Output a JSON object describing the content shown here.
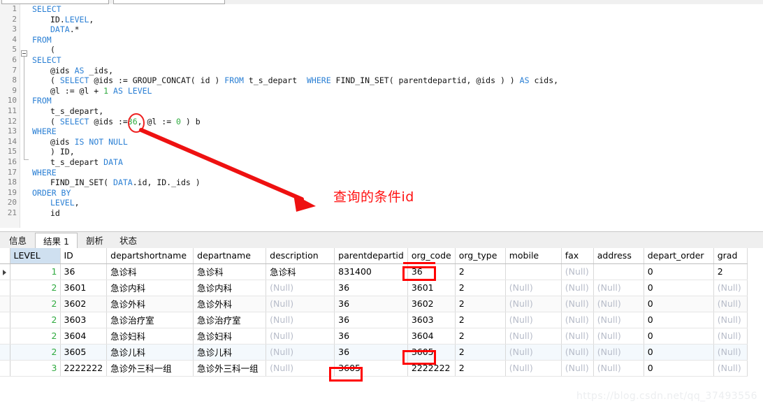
{
  "toolbar": {
    "box1_label": "",
    "box2_label": ""
  },
  "editor": {
    "lines": [
      {
        "n": "1",
        "tokens": [
          {
            "t": "SELECT",
            "c": "kw"
          }
        ],
        "indent": 0
      },
      {
        "n": "2",
        "tokens": [
          {
            "t": "ID.",
            "c": "plain"
          },
          {
            "t": "LEVEL",
            "c": "kw"
          },
          {
            "t": ",",
            "c": "plain"
          }
        ],
        "indent": 1
      },
      {
        "n": "3",
        "tokens": [
          {
            "t": "DATA",
            "c": "kw"
          },
          {
            "t": ".*",
            "c": "plain"
          }
        ],
        "indent": 1
      },
      {
        "n": "4",
        "tokens": [
          {
            "t": "FROM",
            "c": "kw"
          }
        ],
        "indent": 0
      },
      {
        "n": "5",
        "tokens": [
          {
            "t": "(",
            "c": "plain"
          }
        ],
        "indent": 1
      },
      {
        "n": "6",
        "tokens": [
          {
            "t": "SELECT",
            "c": "kw"
          }
        ],
        "indent": 0
      },
      {
        "n": "7",
        "tokens": [
          {
            "t": "@ids ",
            "c": "plain"
          },
          {
            "t": "AS",
            "c": "kw"
          },
          {
            "t": " _ids,",
            "c": "plain"
          }
        ],
        "indent": 1
      },
      {
        "n": "8",
        "tokens": [
          {
            "t": "( ",
            "c": "plain"
          },
          {
            "t": "SELECT",
            "c": "kw"
          },
          {
            "t": " @ids := GROUP_CONCAT( id ) ",
            "c": "plain"
          },
          {
            "t": "FROM",
            "c": "kw"
          },
          {
            "t": " t_s_depart  ",
            "c": "plain"
          },
          {
            "t": "WHERE",
            "c": "kw"
          },
          {
            "t": " FIND_IN_SET( parentdepartid, @ids ) ) ",
            "c": "plain"
          },
          {
            "t": "AS",
            "c": "kw"
          },
          {
            "t": " cids,",
            "c": "plain"
          }
        ],
        "indent": 1
      },
      {
        "n": "9",
        "tokens": [
          {
            "t": "@l := @l + ",
            "c": "plain"
          },
          {
            "t": "1",
            "c": "num"
          },
          {
            "t": " ",
            "c": "plain"
          },
          {
            "t": "AS",
            "c": "kw"
          },
          {
            "t": " ",
            "c": "plain"
          },
          {
            "t": "LEVEL",
            "c": "kw"
          }
        ],
        "indent": 1
      },
      {
        "n": "10",
        "tokens": [
          {
            "t": "FROM",
            "c": "kw"
          }
        ],
        "indent": 0
      },
      {
        "n": "11",
        "tokens": [
          {
            "t": "t_s_depart,",
            "c": "plain"
          }
        ],
        "indent": 1
      },
      {
        "n": "12",
        "tokens": [
          {
            "t": "( ",
            "c": "plain"
          },
          {
            "t": "SELECT",
            "c": "kw"
          },
          {
            "t": " @ids :=",
            "c": "plain"
          },
          {
            "t": "36",
            "c": "num"
          },
          {
            "t": ", @l := ",
            "c": "plain"
          },
          {
            "t": "0",
            "c": "num"
          },
          {
            "t": " ) b",
            "c": "plain"
          }
        ],
        "indent": 1
      },
      {
        "n": "13",
        "tokens": [
          {
            "t": "WHERE",
            "c": "kw"
          }
        ],
        "indent": 0
      },
      {
        "n": "14",
        "tokens": [
          {
            "t": "@ids ",
            "c": "plain"
          },
          {
            "t": "IS NOT NULL",
            "c": "kw"
          }
        ],
        "indent": 1
      },
      {
        "n": "15",
        "tokens": [
          {
            "t": ") ID,",
            "c": "plain"
          }
        ],
        "indent": 1
      },
      {
        "n": "16",
        "tokens": [
          {
            "t": "t_s_depart ",
            "c": "plain"
          },
          {
            "t": "DATA",
            "c": "kw"
          }
        ],
        "indent": 1
      },
      {
        "n": "17",
        "tokens": [
          {
            "t": "WHERE",
            "c": "kw"
          }
        ],
        "indent": 0
      },
      {
        "n": "18",
        "tokens": [
          {
            "t": "FIND_IN_SET( ",
            "c": "plain"
          },
          {
            "t": "DATA",
            "c": "kw"
          },
          {
            "t": ".id, ID._ids )",
            "c": "plain"
          }
        ],
        "indent": 1
      },
      {
        "n": "19",
        "tokens": [
          {
            "t": "ORDER BY",
            "c": "kw"
          }
        ],
        "indent": 0
      },
      {
        "n": "20",
        "tokens": [
          {
            "t": "LEVEL",
            "c": "kw"
          },
          {
            "t": ",",
            "c": "plain"
          }
        ],
        "indent": 1
      },
      {
        "n": "21",
        "tokens": [
          {
            "t": "id",
            "c": "plain"
          }
        ],
        "indent": 1
      }
    ]
  },
  "annotation": {
    "text": "查询的条件id",
    "color": "#ff1111",
    "circled_value": "36"
  },
  "result_tabs": [
    {
      "label": "信息",
      "active": false
    },
    {
      "label": "结果 1",
      "active": true
    },
    {
      "label": "剖析",
      "active": false
    },
    {
      "label": "状态",
      "active": false
    }
  ],
  "grid": {
    "columns": [
      "LEVEL",
      "ID",
      "departshortname",
      "departname",
      "description",
      "parentdepartid",
      "org_code",
      "org_type",
      "mobile",
      "fax",
      "address",
      "depart_order",
      "grad"
    ],
    "selected_column": "LEVEL",
    "null_label": "(Null)",
    "rows": [
      {
        "current": true,
        "cells": [
          "1",
          "36",
          "急诊科",
          "急诊科",
          "急诊科",
          "831400",
          "36",
          "2",
          "",
          "(Null)",
          "",
          "0",
          "2"
        ]
      },
      {
        "current": false,
        "cells": [
          "2",
          "3601",
          "急诊内科",
          "急诊内科",
          "(Null)",
          "36",
          "3601",
          "2",
          "(Null)",
          "(Null)",
          "(Null)",
          "0",
          "(Null)"
        ]
      },
      {
        "current": false,
        "cells": [
          "2",
          "3602",
          "急诊外科",
          "急诊外科",
          "(Null)",
          "36",
          "3602",
          "2",
          "(Null)",
          "(Null)",
          "(Null)",
          "0",
          "(Null)"
        ]
      },
      {
        "current": false,
        "cells": [
          "2",
          "3603",
          "急诊治疗室",
          "急诊治疗室",
          "(Null)",
          "36",
          "3603",
          "2",
          "(Null)",
          "(Null)",
          "(Null)",
          "0",
          "(Null)"
        ]
      },
      {
        "current": false,
        "cells": [
          "2",
          "3604",
          "急诊妇科",
          "急诊妇科",
          "(Null)",
          "36",
          "3604",
          "2",
          "(Null)",
          "(Null)",
          "(Null)",
          "0",
          "(Null)"
        ]
      },
      {
        "current": false,
        "cells": [
          "2",
          "3605",
          "急诊儿科",
          "急诊儿科",
          "(Null)",
          "36",
          "3605",
          "2",
          "(Null)",
          "(Null)",
          "(Null)",
          "0",
          "(Null)"
        ]
      },
      {
        "current": false,
        "cells": [
          "3",
          "2222222",
          "急诊外三科一组",
          "急诊外三科一组",
          "(Null)",
          "3605",
          "2222222",
          "2",
          "(Null)",
          "(Null)",
          "(Null)",
          "0",
          "(Null)"
        ]
      }
    ],
    "highlights": [
      {
        "label": "36",
        "row": 0,
        "column": "org_code"
      },
      {
        "label": "3605",
        "row": 5,
        "column": "org_code"
      },
      {
        "label": "3605",
        "row": 6,
        "column": "parentdepartid"
      }
    ]
  },
  "watermark": {
    "text": "https://blog.csdn.net/qq_37493556"
  }
}
